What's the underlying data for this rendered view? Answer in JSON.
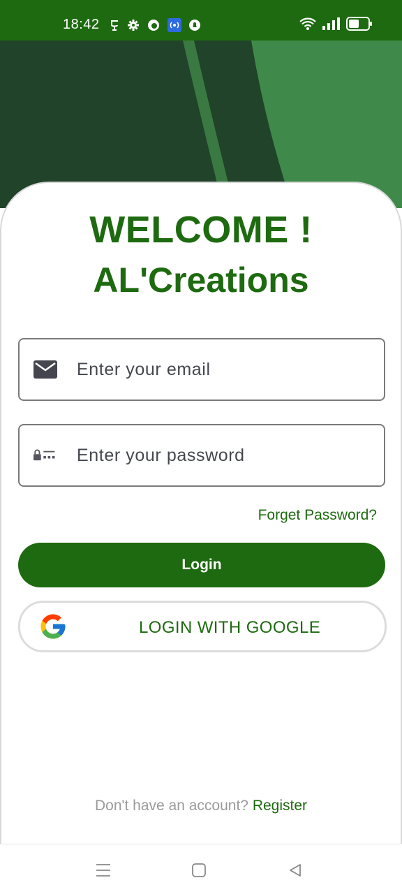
{
  "status_bar": {
    "time": "18:42",
    "icons_left": [
      "hotspot-icon",
      "gear-icon",
      "notification-app-icon",
      "nfc-icon",
      "alert-icon"
    ],
    "icons_right": [
      "wifi-icon",
      "signal-icon",
      "battery-icon"
    ]
  },
  "login": {
    "welcome": "WELCOME !",
    "app_name": "AL'Creations",
    "email_placeholder": "Enter your email",
    "password_placeholder": "Enter your password",
    "forgot_label": "Forget Password?",
    "login_label": "Login",
    "google_label": "LOGIN WITH GOOGLE",
    "no_account_text": "Don't have an account?",
    "register_label": "Register"
  },
  "colors": {
    "primary": "#1e6a10",
    "banner": "#20432a",
    "banner_light": "#3f8a4a"
  },
  "nav_bar": {
    "buttons": [
      "menu-icon",
      "home-icon",
      "back-icon"
    ]
  }
}
